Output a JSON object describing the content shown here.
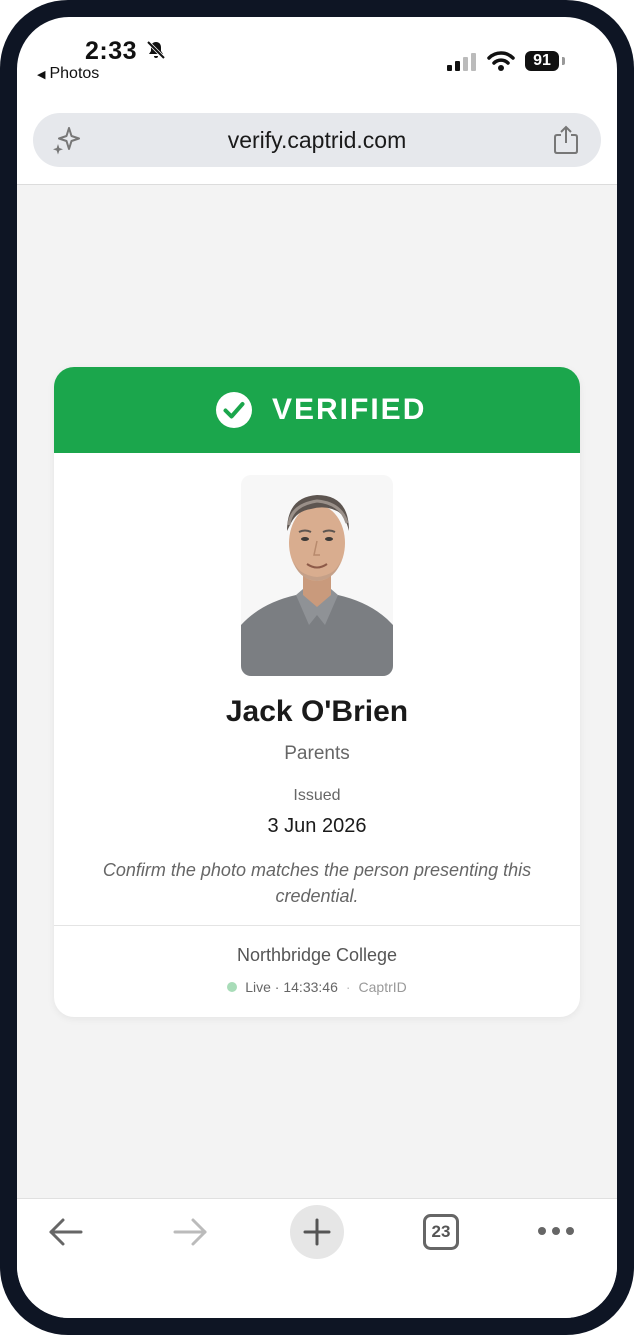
{
  "status_bar": {
    "time": "2:33",
    "back_app": "Photos",
    "battery": "91"
  },
  "browser": {
    "url": "verify.captrid.com",
    "tab_count": "23"
  },
  "card": {
    "status_label": "VERIFIED",
    "name": "Jack O'Brien",
    "role": "Parents",
    "issued_label": "Issued",
    "issued_date": "3 Jun 2026",
    "note": "Confirm the photo matches the person presenting this credential.",
    "organization": "Northbridge College",
    "live_label": "Live",
    "live_time": "14:33:46",
    "brand": "CaptrID"
  },
  "colors": {
    "verified_green": "#1ba64c",
    "frame": "#0e1524",
    "live_dot": "#a8dcb8"
  },
  "icons": [
    "bell-slash-icon",
    "signal-icon",
    "wifi-icon",
    "sparkle-icon",
    "share-icon",
    "check-circle-icon",
    "back-arrow-icon",
    "forward-arrow-icon",
    "plus-icon",
    "tabs-icon",
    "more-icon"
  ]
}
